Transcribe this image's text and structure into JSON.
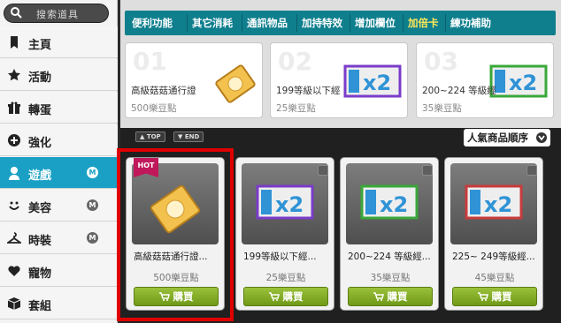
{
  "search": {
    "placeholder": "搜索道具"
  },
  "sidebar": {
    "items": [
      {
        "label": "主頁",
        "icon": "bookmark-icon",
        "badge": ""
      },
      {
        "label": "活動",
        "icon": "star-icon",
        "badge": ""
      },
      {
        "label": "轉蛋",
        "icon": "gift-box-icon",
        "badge": ""
      },
      {
        "label": "強化",
        "icon": "plus-circle-icon",
        "badge": ""
      },
      {
        "label": "遊戲",
        "icon": "character-icon",
        "badge": "M",
        "active": true
      },
      {
        "label": "美容",
        "icon": "face-icon",
        "badge": "M"
      },
      {
        "label": "時裝",
        "icon": "hanger-icon",
        "badge": "M"
      },
      {
        "label": "寵物",
        "icon": "heart-icon",
        "badge": ""
      },
      {
        "label": "套組",
        "icon": "package-icon",
        "badge": ""
      }
    ]
  },
  "tabs": [
    "便利功能",
    "其它消耗",
    "通訊物品",
    "加持特效",
    "增加欄位",
    "加倍卡",
    "練功補助"
  ],
  "selected_tab": "加倍卡",
  "featured": [
    {
      "rank": "01",
      "name": "高級菇菇通行證",
      "price": "500樂豆點"
    },
    {
      "rank": "02",
      "name": "199等級以下經",
      "price": "25樂豆點"
    },
    {
      "rank": "03",
      "name": "200~224 等級經",
      "price": "35樂豆點"
    }
  ],
  "controls": {
    "top_label": "TOP",
    "end_label": "END",
    "sort_label": "人氣商品順序"
  },
  "products": [
    {
      "name": "高級菇菇通行證...",
      "price": "500樂豆點",
      "buy": "購買",
      "hot": "HOT"
    },
    {
      "name": "199等級以下經...",
      "price": "25樂豆點",
      "buy": "購買"
    },
    {
      "name": "200~224 等級經...",
      "price": "35樂豆點",
      "buy": "購買"
    },
    {
      "name": "225~ 249等級經...",
      "price": "45樂豆點",
      "buy": "購買"
    }
  ],
  "colors": {
    "accent": "#1aa0c4",
    "tab_bar": "#0f7f8e",
    "buy": "#7fa825",
    "highlight": "#e00000"
  }
}
